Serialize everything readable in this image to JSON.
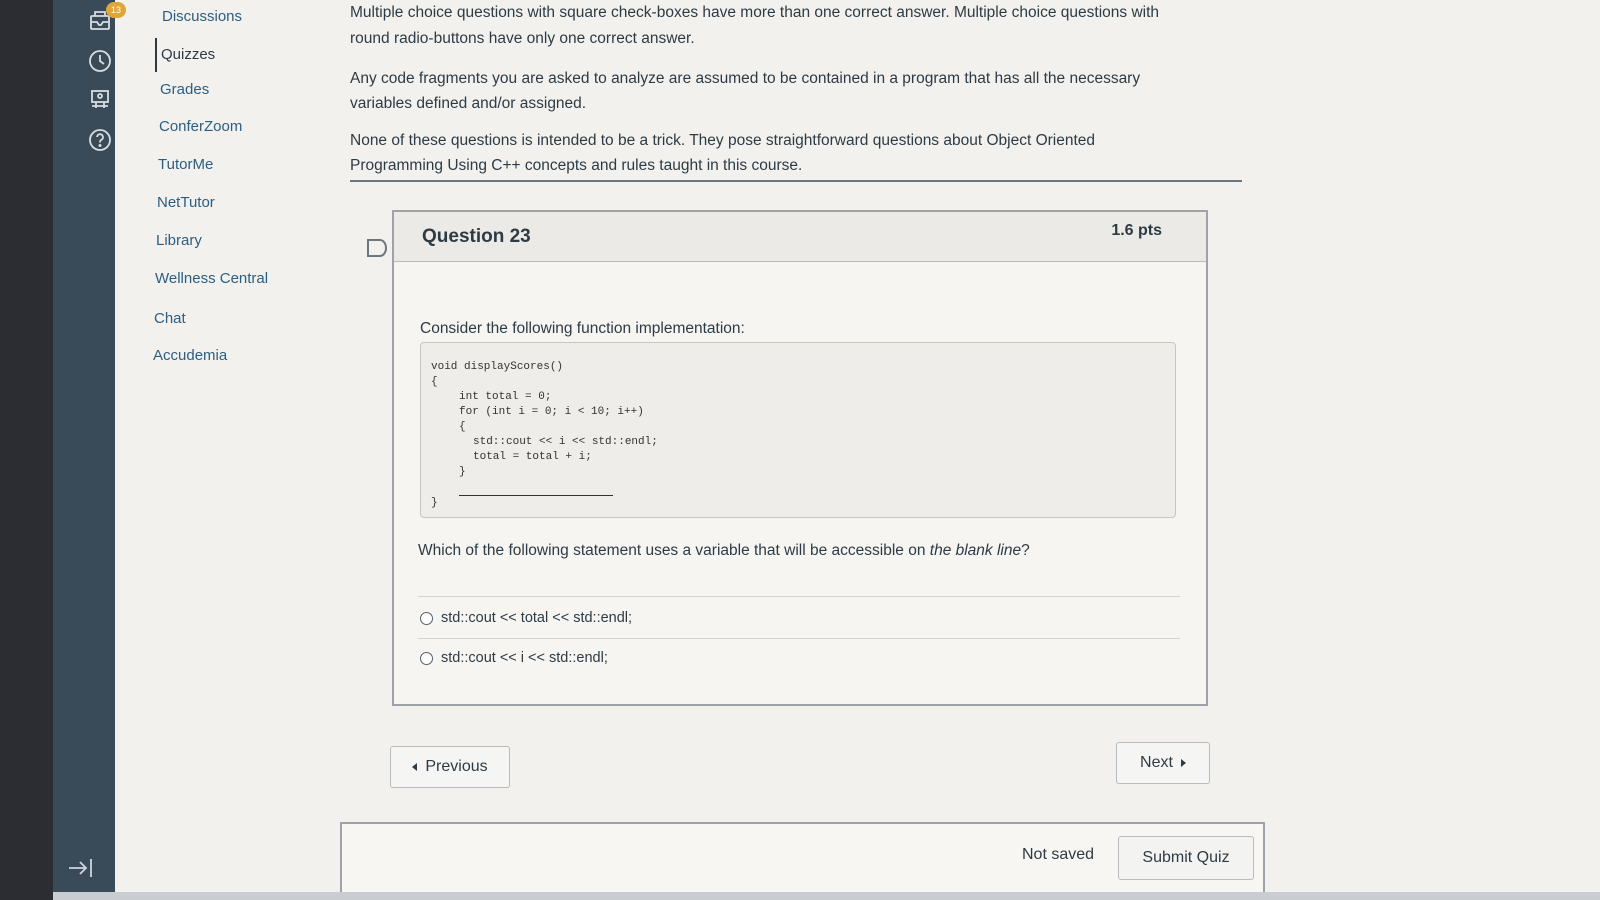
{
  "global_nav": {
    "badge_count": "13",
    "icons": [
      "inbox-icon",
      "history-icon",
      "commons-icon",
      "help-icon"
    ]
  },
  "course_nav": {
    "items": [
      {
        "label": "Discussions"
      },
      {
        "label": "Quizzes"
      },
      {
        "label": "Grades"
      },
      {
        "label": "ConferZoom"
      },
      {
        "label": "TutorMe"
      },
      {
        "label": "NetTutor"
      },
      {
        "label": "Library"
      },
      {
        "label": "Wellness Central"
      },
      {
        "label": "Chat"
      },
      {
        "label": "Accudemia"
      }
    ]
  },
  "intro": {
    "p1_line1": "Multiple choice questions with square check-boxes have more than one correct answer.  Multiple choice questions with",
    "p1_line2": "round radio-buttons have only one correct answer.",
    "p2_line1": "Any code fragments you are asked to analyze are assumed to be contained in a program that has all the necessary",
    "p2_line2": "variables defined and/or assigned.",
    "p3_line1": "None of these questions is intended to be a trick.  They pose straightforward questions about Object Oriented",
    "p3_line2": "Programming Using C++  concepts and rules taught in this course."
  },
  "question": {
    "title": "Question 23",
    "points": "1.6 pts",
    "prompt": "Consider the following function implementation:",
    "code": [
      "void displayScores()",
      "{",
      "int total = 0;",
      "for (int i = 0; i < 10; i++)",
      "{",
      "std::cout << i << std::endl;",
      "total = total + i;",
      "}",
      "}"
    ],
    "ask_before": "Which of the following statement uses a variable that will be accessible on ",
    "ask_emphasis": "the blank line",
    "ask_after": "?",
    "answers": [
      {
        "label": "std::cout << total << std::endl;"
      },
      {
        "label": "std::cout << i << std::endl;"
      }
    ]
  },
  "navigation": {
    "previous_label": "Previous",
    "next_label": "Next"
  },
  "footer": {
    "status": "Not saved",
    "submit_label": "Submit Quiz"
  }
}
